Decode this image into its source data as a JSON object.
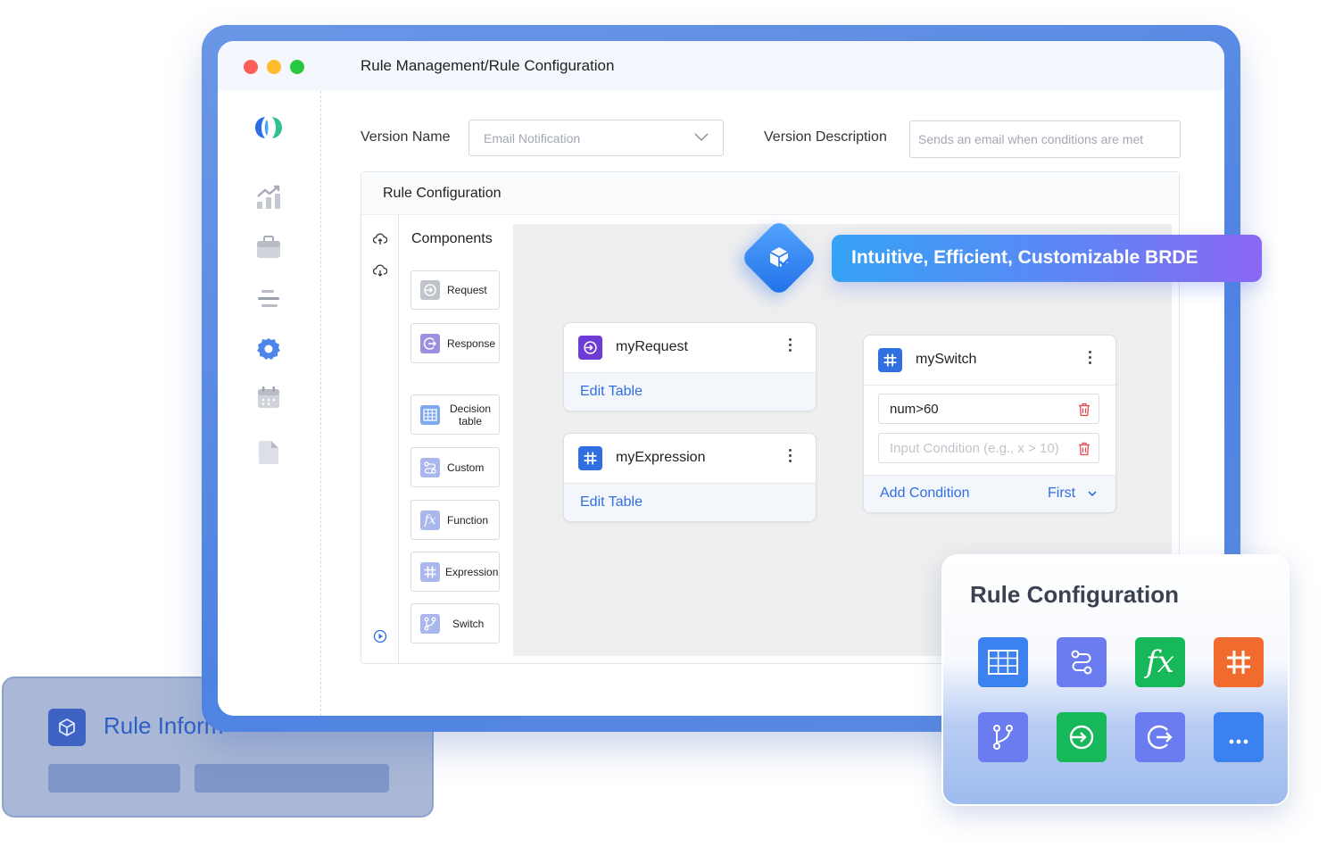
{
  "window": {
    "title": "Rule Management/Rule Configuration",
    "traffic_lights": [
      "#ff5f57",
      "#febc2e",
      "#28c840"
    ]
  },
  "sidebar": {
    "items": [
      {
        "icon": "app-logo-icon"
      },
      {
        "icon": "analytics-chart-icon"
      },
      {
        "icon": "briefcase-icon"
      },
      {
        "icon": "menu-lines-icon"
      },
      {
        "icon": "gear-icon"
      },
      {
        "icon": "calendar-icon"
      },
      {
        "icon": "document-icon"
      }
    ]
  },
  "form": {
    "version_name_label": "Version Name",
    "version_name_value": "Email Notification",
    "version_description_label": "Version Description",
    "version_description_placeholder": "Sends an email when conditions are met"
  },
  "rule_config": {
    "header": "Rule Configuration",
    "components_title": "Components",
    "components": [
      {
        "label": "Request",
        "icon": "request-icon"
      },
      {
        "label": "Response",
        "icon": "response-icon"
      },
      {
        "label": "Decision table",
        "icon": "table-icon"
      },
      {
        "label": "Custom",
        "icon": "custom-flow-icon"
      },
      {
        "label": "Function",
        "icon": "function-icon"
      },
      {
        "label": "Expression",
        "icon": "hash-icon"
      },
      {
        "label": "Switch",
        "icon": "branch-icon"
      }
    ]
  },
  "nodes": {
    "request": {
      "title": "myRequest",
      "link": "Edit Table"
    },
    "expression": {
      "title": "myExpression",
      "link": "Edit Table"
    },
    "switch": {
      "title": "mySwitch",
      "condition_1": "num>60",
      "condition_placeholder": "Input Condition (e.g., x > 10)",
      "add_condition": "Add Condition",
      "mode": "First"
    }
  },
  "banner": {
    "text": "Intuitive, Efficient, Customizable BRDE"
  },
  "card": {
    "title": "Rule Configuration",
    "tiles": [
      {
        "icon": "table-icon",
        "color": "#3b82f0"
      },
      {
        "icon": "custom-flow-icon",
        "color": "#6a7cf0"
      },
      {
        "icon": "function-icon",
        "color": "#17b85a"
      },
      {
        "icon": "hash-icon",
        "color": "#f26b2e"
      },
      {
        "icon": "branch-icon",
        "color": "#6a7cf0"
      },
      {
        "icon": "request-icon",
        "color": "#17b85a"
      },
      {
        "icon": "response-icon",
        "color": "#6a7cf0"
      },
      {
        "icon": "more-icon",
        "color": "#3b82f0"
      }
    ]
  },
  "info_card": {
    "title": "Rule Inform"
  }
}
